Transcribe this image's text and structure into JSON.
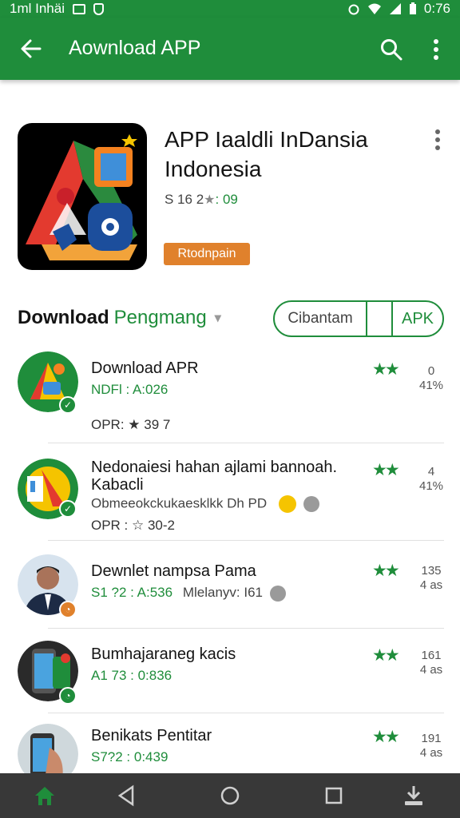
{
  "status_bar": {
    "left_text": "1ml Inhäi",
    "time": "0:76"
  },
  "app_bar": {
    "title": "Aownload APP"
  },
  "hero": {
    "title": "APP Iaaldli InDansia Indonesia",
    "rating_prefix": "S 16 2",
    "rating_star": "★",
    "rating_value": ": 09",
    "badge": "Rtodnpain"
  },
  "section": {
    "title": "Download",
    "accent": "Pengmang",
    "chevron": "▾",
    "segment_left": "Cibantam",
    "segment_right": "APK"
  },
  "list": [
    {
      "title": "Download APR",
      "meta": "NDFl : A:026",
      "desc": "",
      "sub": "OPR: ★ 39 7",
      "stars": "★★",
      "count_top": "0",
      "count_bottom": "41%"
    },
    {
      "title": "Nedonaiesi hahan ajlami bannoah.",
      "title2": "Kabacli",
      "meta": "",
      "desc": "Obmeeokckukaesklkk Dh PD",
      "sub": "OPR : ☆ 30-2",
      "stars": "★★",
      "count_top": "4",
      "count_bottom": "41%"
    },
    {
      "title": "Dewnlet nampsa Pama",
      "meta": "S1 ?2 : A:536",
      "desc": "Mlelanyv: I61",
      "sub": "",
      "stars": "★★",
      "count_top": "135",
      "count_bottom": "4 as"
    },
    {
      "title": "Bumhajaraneg kacis",
      "meta": "A1 73 : 0:836",
      "desc": "",
      "sub": "",
      "stars": "★★",
      "count_top": "161",
      "count_bottom": "4 as"
    },
    {
      "title": "Benikats Pentitar",
      "meta": "S7?2 : 0:439",
      "desc": "",
      "sub": "",
      "stars": "★★",
      "count_top": "191",
      "count_bottom": "4 as"
    }
  ],
  "colors": {
    "primary": "#1f8d3b",
    "badge": "#e0812c",
    "navbar": "#383838"
  },
  "icons": [
    "back-arrow-icon",
    "search-icon",
    "more-vert-icon",
    "home-icon",
    "back-triangle-icon",
    "circle-home-icon",
    "square-recents-icon",
    "download-icon"
  ]
}
